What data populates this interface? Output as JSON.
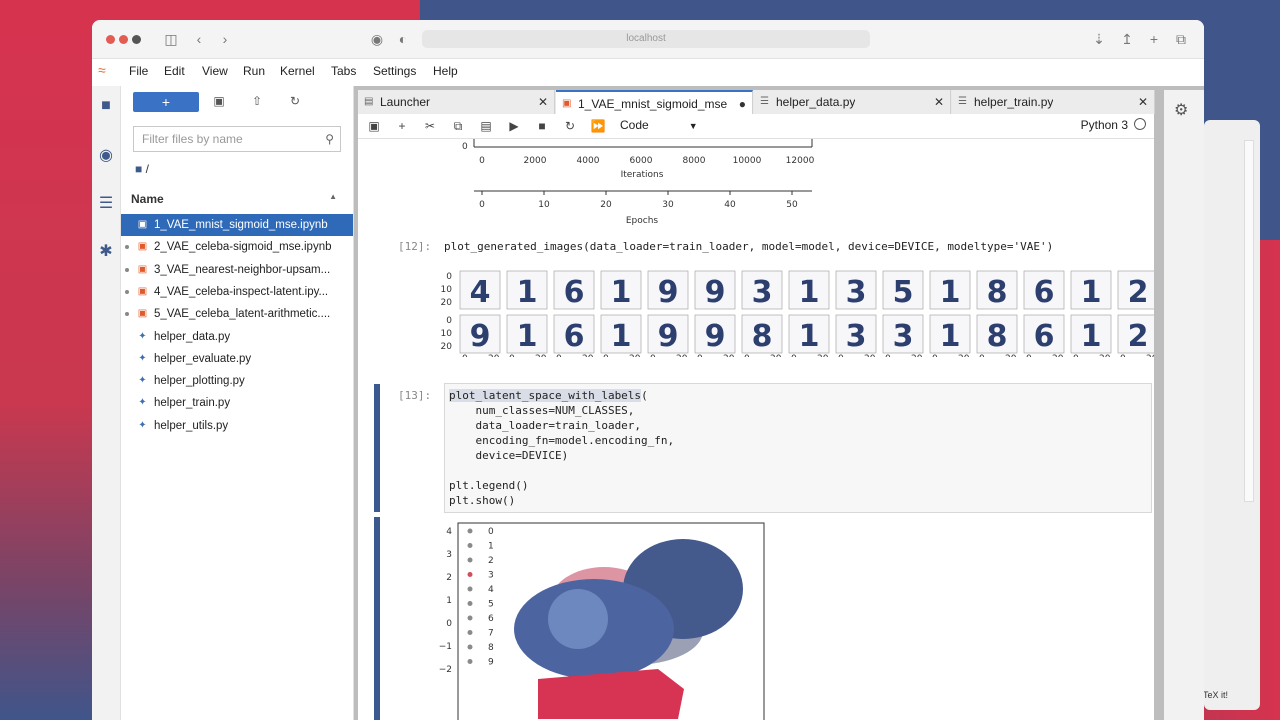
{
  "browser": {
    "url": "localhost"
  },
  "menu": [
    "File",
    "Edit",
    "View",
    "Run",
    "Kernel",
    "Tabs",
    "Settings",
    "Help"
  ],
  "file_browser": {
    "new_button": "+",
    "filter_placeholder": "Filter files by name",
    "path": "/",
    "column_name": "Name",
    "files": [
      {
        "name": "1_VAE_mnist_sigmoid_mse.ipynb",
        "type": "notebook",
        "selected": true,
        "running": false
      },
      {
        "name": "2_VAE_celeba-sigmoid_mse.ipynb",
        "type": "notebook",
        "selected": false,
        "running": true
      },
      {
        "name": "3_VAE_nearest-neighbor-upsam...",
        "type": "notebook",
        "selected": false,
        "running": true
      },
      {
        "name": "4_VAE_celeba-inspect-latent.ipy...",
        "type": "notebook",
        "selected": false,
        "running": true
      },
      {
        "name": "5_VAE_celeba_latent-arithmetic....",
        "type": "notebook",
        "selected": false,
        "running": true
      },
      {
        "name": "helper_data.py",
        "type": "python",
        "selected": false,
        "running": false
      },
      {
        "name": "helper_evaluate.py",
        "type": "python",
        "selected": false,
        "running": false
      },
      {
        "name": "helper_plotting.py",
        "type": "python",
        "selected": false,
        "running": false
      },
      {
        "name": "helper_train.py",
        "type": "python",
        "selected": false,
        "running": false
      },
      {
        "name": "helper_utils.py",
        "type": "python",
        "selected": false,
        "running": false
      }
    ]
  },
  "tabs": [
    {
      "label": "Launcher",
      "icon": "launcher-icon",
      "active": false
    },
    {
      "label": "1_VAE_mnist_sigmoid_mse.",
      "icon": "notebook-icon",
      "active": true
    },
    {
      "label": "helper_data.py",
      "icon": "python-file-icon",
      "active": false
    },
    {
      "label": "helper_train.py",
      "icon": "python-file-icon",
      "active": false
    }
  ],
  "toolbar": {
    "cell_type": "Code",
    "kernel": "Python 3"
  },
  "loss_plot": {
    "y_tick": "0",
    "iter_ticks": [
      "0",
      "2000",
      "4000",
      "6000",
      "8000",
      "10000",
      "12000"
    ],
    "iter_label": "Iterations",
    "epoch_ticks": [
      "0",
      "10",
      "20",
      "30",
      "40",
      "50"
    ],
    "epoch_label": "Epochs"
  },
  "cell12": {
    "prompt": "[12]:",
    "code": "plot_generated_images(data_loader=train_loader, model=model, device=DEVICE, modeltype='VAE')"
  },
  "generated_images": {
    "original_row": [
      "4",
      "1",
      "6",
      "1",
      "9",
      "9",
      "3",
      "1",
      "3",
      "5",
      "1",
      "8",
      "6",
      "1",
      "2"
    ],
    "reconstructed_row": [
      "9",
      "1",
      "6",
      "1",
      "9",
      "9",
      "8",
      "1",
      "3",
      "3",
      "1",
      "8",
      "6",
      "1",
      "2"
    ],
    "y_ticks": [
      "0",
      "10",
      "20"
    ],
    "x_ticks": [
      "0",
      "20"
    ]
  },
  "cell13": {
    "prompt": "[13]:",
    "lines": [
      "plot_latent_space_with_labels(",
      "    num_classes=NUM_CLASSES,",
      "    data_loader=train_loader,",
      "    encoding_fn=model.encoding_fn,",
      "    device=DEVICE)",
      "",
      "plt.legend()",
      "plt.show()"
    ]
  },
  "latent_plot": {
    "y_ticks": [
      "4",
      "3",
      "2",
      "1",
      "0",
      "−1",
      "−2"
    ],
    "legend": [
      "0",
      "1",
      "2",
      "3",
      "4",
      "5",
      "6",
      "7",
      "8",
      "9"
    ]
  }
}
